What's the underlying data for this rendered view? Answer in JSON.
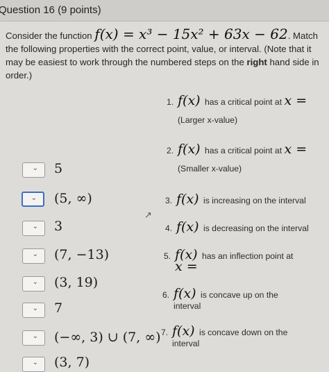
{
  "question": {
    "title": "Question 16",
    "points": "(9 points)"
  },
  "intro": {
    "pre": "Consider the function ",
    "formula": "f(x) = x³ − 15x² + 63x − 62",
    "post1": ". Match the following properties with the correct point, value, or interval. (Note that it may be easiest to work through the numbered steps on the ",
    "bold": "right",
    "post2": " hand side in order.)"
  },
  "properties": [
    {
      "num": "1.",
      "func": "f(x)",
      "text": "has a critical point at",
      "var": "x =",
      "sub": "(Larger x-value)"
    },
    {
      "num": "2.",
      "func": "f(x)",
      "text": "has a critical point at",
      "var": "x =",
      "sub": "(Smaller x-value)"
    },
    {
      "num": "3.",
      "func": "f(x)",
      "text": "is increasing on the interval"
    },
    {
      "num": "4.",
      "func": "f(x)",
      "text": "is decreasing on the interval"
    },
    {
      "num": "5.",
      "func": "f(x)",
      "text": "has an inflection point at",
      "var": "x ="
    },
    {
      "num": "6.",
      "func": "f(x)",
      "text": "is concave up on the",
      "sub": "interval"
    },
    {
      "num": "7.",
      "func": "f(x)",
      "text": "is concave down on the",
      "sub": "interval"
    }
  ],
  "options": [
    {
      "value": "5",
      "selected": ""
    },
    {
      "value": "(5, ∞)",
      "selected": ""
    },
    {
      "value": "3",
      "selected": ""
    },
    {
      "value": "(7, −13)",
      "selected": ""
    },
    {
      "value": "(3, 19)",
      "selected": ""
    },
    {
      "value": "7",
      "selected": ""
    },
    {
      "value": "(−∞, 3) ∪ (7, ∞)",
      "selected": ""
    },
    {
      "value": "(3, 7)",
      "selected": ""
    }
  ],
  "dropdown_icon": "chevron-down-icon",
  "colors": {
    "background": "#dedcd8",
    "header": "#cfcdca",
    "focus_border": "#3a6fc2"
  }
}
